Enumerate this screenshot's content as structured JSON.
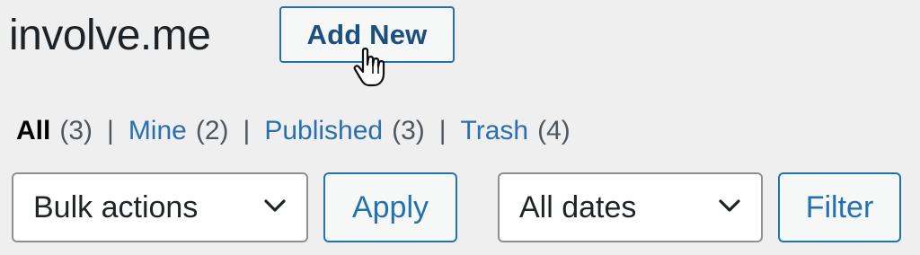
{
  "header": {
    "title": "involve.me",
    "add_new_label": "Add New"
  },
  "views": {
    "all": {
      "label": "All",
      "count": "(3)"
    },
    "mine": {
      "label": "Mine",
      "count": "(2)"
    },
    "published": {
      "label": "Published",
      "count": "(3)"
    },
    "trash": {
      "label": "Trash",
      "count": "(4)"
    },
    "separator": "|"
  },
  "toolbar": {
    "bulk_actions": "Bulk actions",
    "apply_label": "Apply",
    "dates": "All dates",
    "filter_label": "Filter"
  },
  "colors": {
    "accent": "#2271b1",
    "background": "#efefef"
  },
  "icons": {
    "cursor": "hand-pointer-icon",
    "dropdown": "chevron-down-icon"
  }
}
